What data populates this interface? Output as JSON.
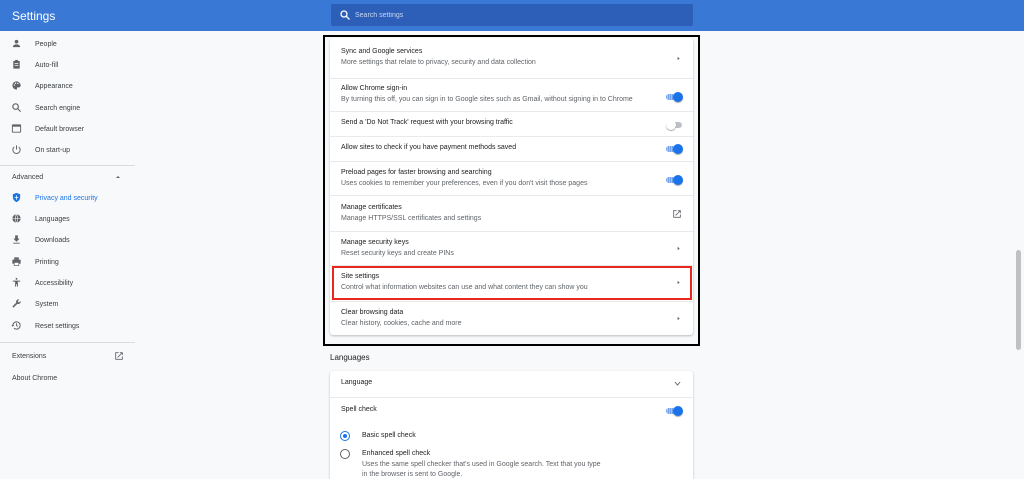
{
  "header": {
    "title": "Settings",
    "search_placeholder": "Search settings",
    "background": "#3a78d6"
  },
  "sidebar": {
    "items": [
      {
        "label": "People",
        "icon": "person-icon"
      },
      {
        "label": "Auto-fill",
        "icon": "clipboard-icon"
      },
      {
        "label": "Appearance",
        "icon": "palette-icon"
      },
      {
        "label": "Search engine",
        "icon": "search-icon"
      },
      {
        "label": "Default browser",
        "icon": "browser-window-icon"
      },
      {
        "label": "On start-up",
        "icon": "power-icon"
      }
    ],
    "advanced_label": "Advanced",
    "advanced_items": [
      {
        "label": "Privacy and security",
        "icon": "shield-icon",
        "active": true
      },
      {
        "label": "Languages",
        "icon": "globe-icon"
      },
      {
        "label": "Downloads",
        "icon": "download-icon"
      },
      {
        "label": "Printing",
        "icon": "printer-icon"
      },
      {
        "label": "Accessibility",
        "icon": "accessibility-icon"
      },
      {
        "label": "System",
        "icon": "wrench-icon"
      },
      {
        "label": "Reset settings",
        "icon": "history-icon"
      }
    ],
    "extensions_label": "Extensions",
    "about_label": "About Chrome"
  },
  "privacy": {
    "rows": [
      {
        "title": "Sync and Google services",
        "subtitle": "More settings that relate to privacy, security and data collection",
        "control": "chevron"
      },
      {
        "title": "Allow Chrome sign-in",
        "subtitle": "By turning this off, you can sign in to Google sites such as Gmail, without signing in to Chrome",
        "control": "toggle",
        "on": true
      },
      {
        "title": "Send a 'Do Not Track' request with your browsing traffic",
        "subtitle": "",
        "control": "toggle",
        "on": false
      },
      {
        "title": "Allow sites to check if you have payment methods saved",
        "subtitle": "",
        "control": "toggle",
        "on": true
      },
      {
        "title": "Preload pages for faster browsing and searching",
        "subtitle": "Uses cookies to remember your preferences, even if you don't visit those pages",
        "control": "toggle",
        "on": true
      },
      {
        "title": "Manage certificates",
        "subtitle": "Manage HTTPS/SSL certificates and settings",
        "control": "external"
      },
      {
        "title": "Manage security keys",
        "subtitle": "Reset security keys and create PINs",
        "control": "chevron"
      },
      {
        "title": "Site settings",
        "subtitle": "Control what information websites can use and what content they can show you",
        "control": "chevron"
      },
      {
        "title": "Clear browsing data",
        "subtitle": "Clear history, cookies, cache and more",
        "control": "chevron"
      }
    ]
  },
  "languages": {
    "section_title": "Languages",
    "language_label": "Language",
    "spell_check_label": "Spell check",
    "spell_check_on": true,
    "basic_label": "Basic spell check",
    "enhanced_label": "Enhanced spell check",
    "enhanced_sub_1": "Uses the same spell checker that's used in Google search. Text that you type",
    "enhanced_sub_2": "in the browser is sent to Google."
  },
  "colors": {
    "accent": "#1a73e8",
    "highlight_red": "#e8281d"
  }
}
